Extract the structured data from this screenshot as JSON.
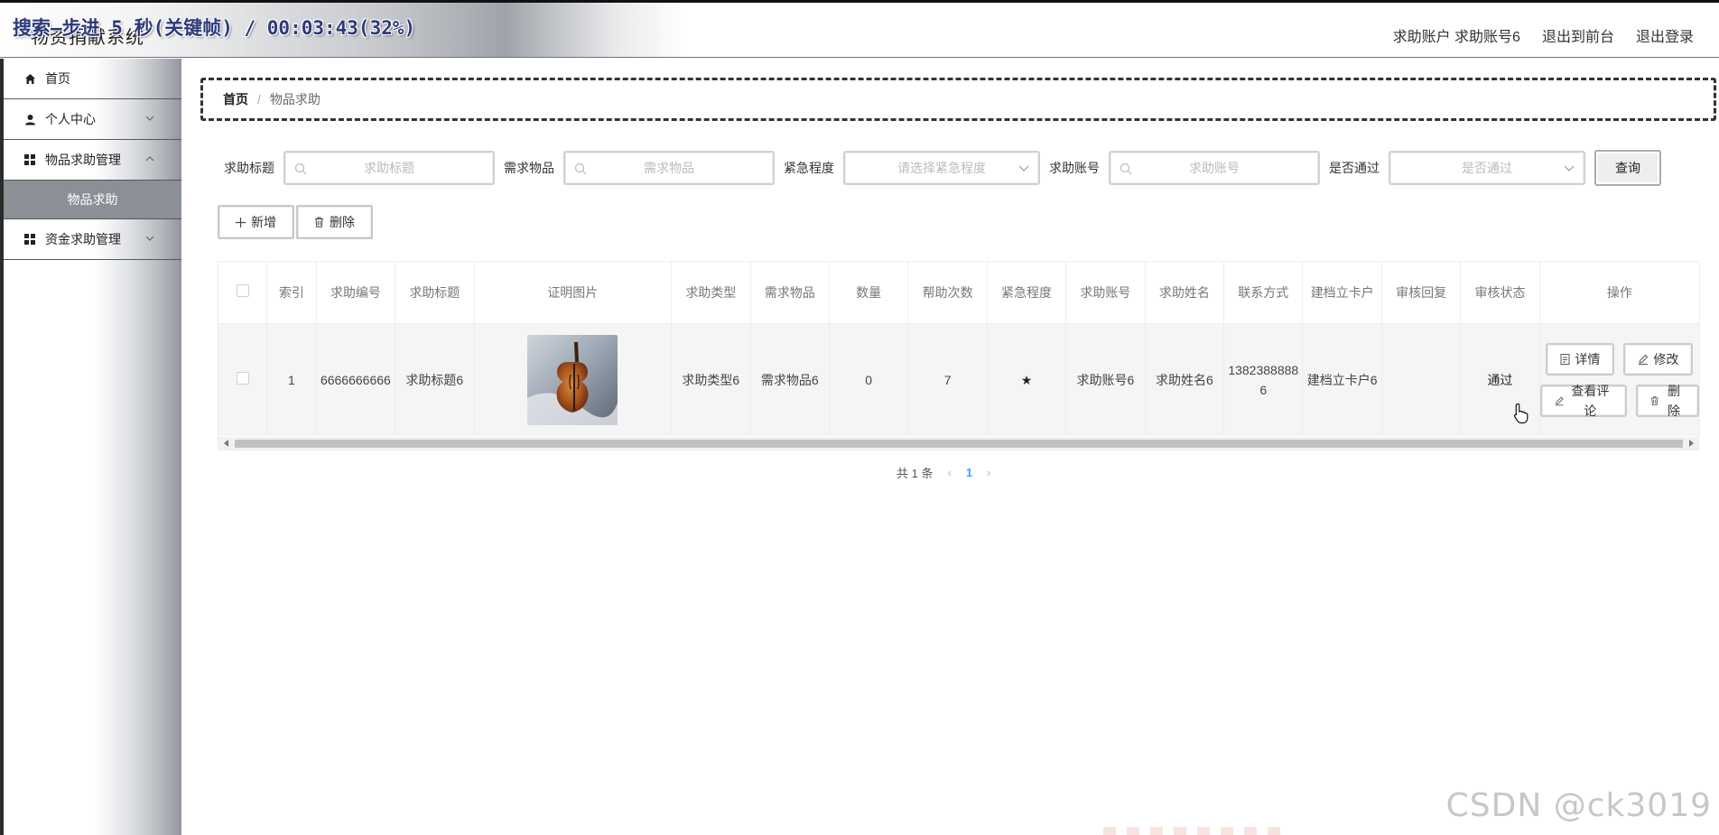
{
  "header": {
    "title": "物资捐献系统",
    "overlay": "搜索—步进 5 秒(关键帧) / 00:03:43(32%)",
    "user_info": "求助账户 求助账号6",
    "to_front": "退出到前台",
    "logout": "退出登录"
  },
  "sidebar": {
    "home": "首页",
    "personal": "个人中心",
    "goods_mgmt": "物品求助管理",
    "goods_sub": "物品求助",
    "fund_mgmt": "资金求助管理"
  },
  "breadcrumb": {
    "home": "首页",
    "current": "物品求助"
  },
  "search": {
    "title_label": "求助标题",
    "title_placeholder": "求助标题",
    "item_label": "需求物品",
    "item_placeholder": "需求物品",
    "urgency_label": "紧急程度",
    "urgency_placeholder": "请选择紧急程度",
    "account_label": "求助账号",
    "account_placeholder": "求助账号",
    "pass_label": "是否通过",
    "pass_placeholder": "是否通过",
    "query": "查询"
  },
  "actions": {
    "add": "新增",
    "delete": "删除"
  },
  "table": {
    "headers": [
      "索引",
      "求助编号",
      "求助标题",
      "证明图片",
      "求助类型",
      "需求物品",
      "数量",
      "帮助次数",
      "紧急程度",
      "求助账号",
      "求助姓名",
      "联系方式",
      "建档立卡户",
      "审核回复",
      "审核状态",
      "操作"
    ],
    "rows": [
      {
        "index": "1",
        "code": "6666666666",
        "title": "求助标题6",
        "type": "求助类型6",
        "item": "需求物品6",
        "qty": "0",
        "help_count": "7",
        "urgency": "★",
        "account": "求助账号6",
        "name": "求助姓名6",
        "phone": "13823888886",
        "card": "建档立卡户6",
        "reply": "",
        "status": "通过"
      }
    ],
    "ops": {
      "detail": "详情",
      "edit": "修改",
      "comments": "查看评论",
      "delete": "删除"
    }
  },
  "pager": {
    "total": "共 1 条",
    "page": "1"
  },
  "watermark": "CSDN @ck3019"
}
